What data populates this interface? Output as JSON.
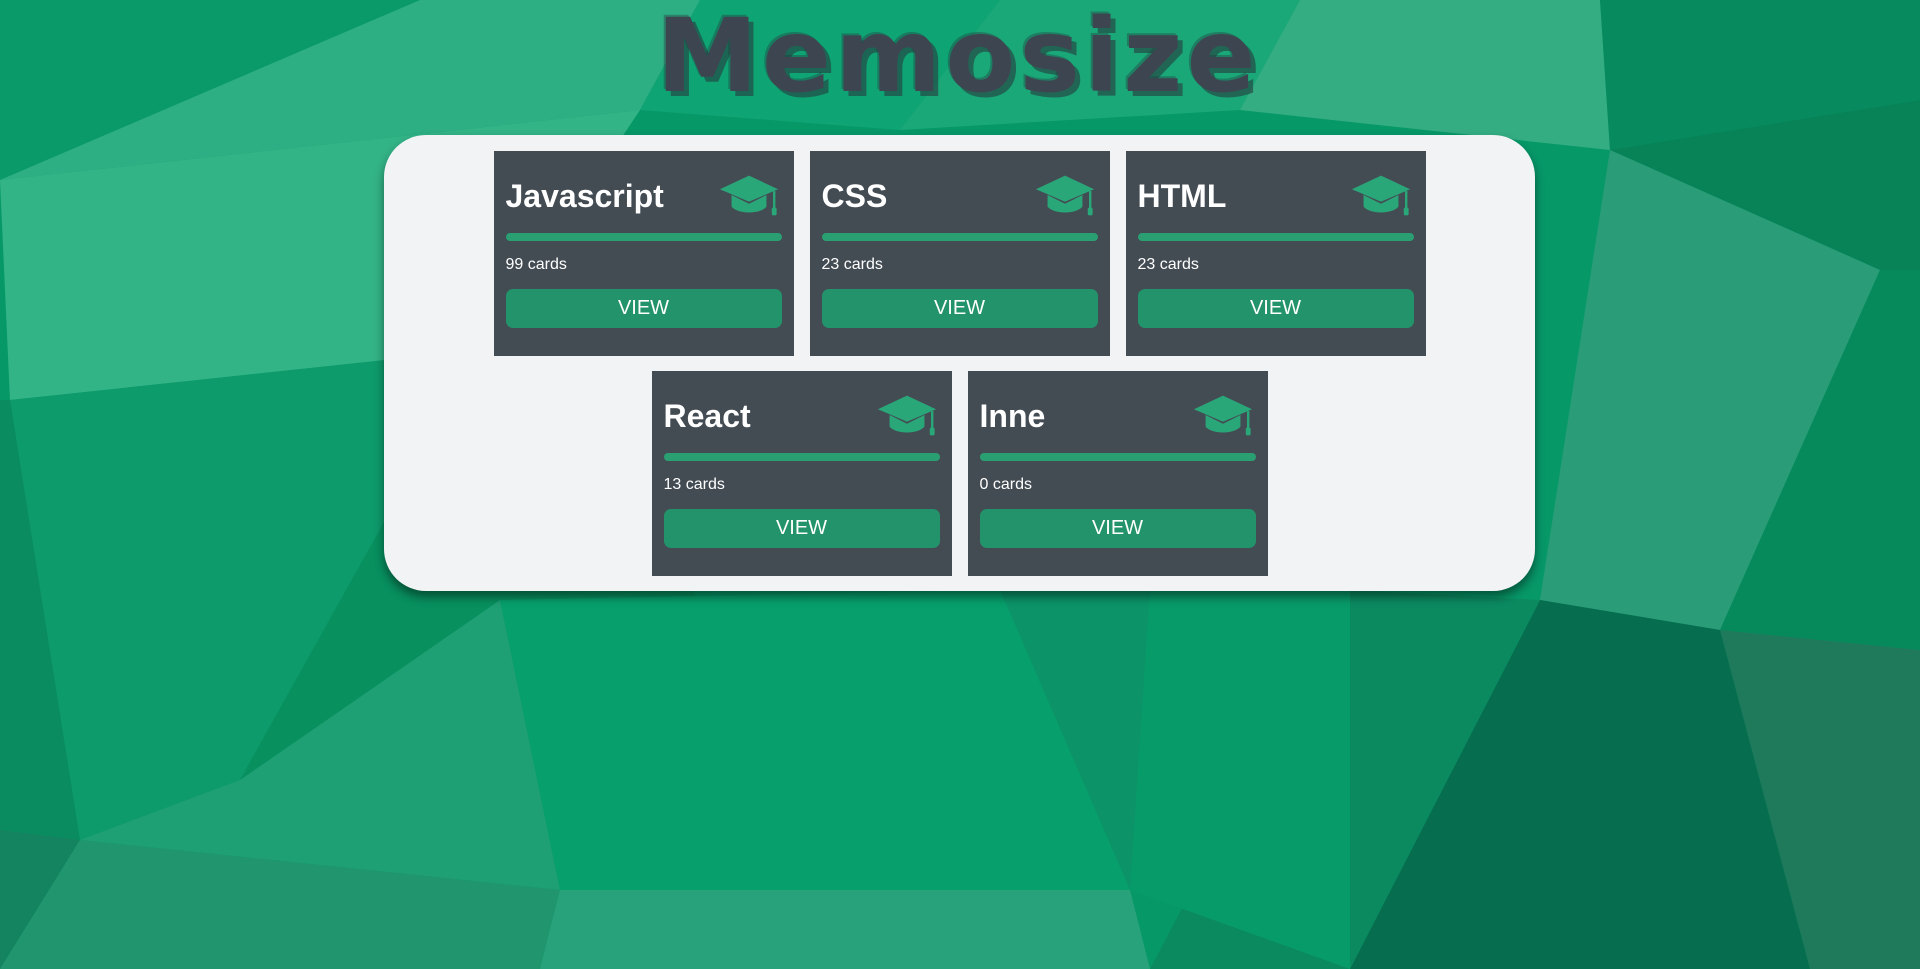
{
  "app": {
    "title": "Memosize"
  },
  "decks": [
    {
      "name": "Javascript",
      "count_label": "99 cards",
      "button_label": "VIEW"
    },
    {
      "name": "CSS",
      "count_label": "23 cards",
      "button_label": "VIEW"
    },
    {
      "name": "HTML",
      "count_label": "23 cards",
      "button_label": "VIEW"
    },
    {
      "name": "React",
      "count_label": "13 cards",
      "button_label": "VIEW"
    },
    {
      "name": "Inne",
      "count_label": "0 cards",
      "button_label": "VIEW"
    }
  ],
  "colors": {
    "accent": "#2a9f72",
    "button": "#23936b",
    "card": "#434b53",
    "panel": "#f1f3f5",
    "title": "#3d4650"
  },
  "icons": {
    "deck_icon": "graduation-cap-icon"
  }
}
